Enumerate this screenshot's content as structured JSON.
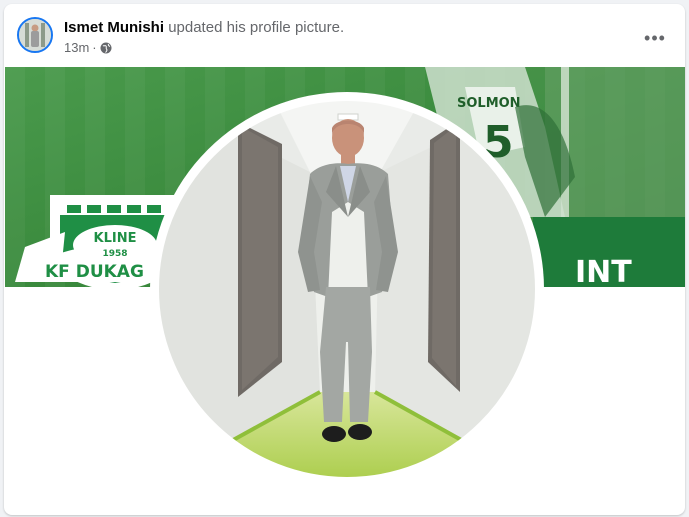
{
  "post": {
    "author_name": "Ismet Munishi",
    "action_text": "updated his profile picture.",
    "timestamp": "13m",
    "separator": "·",
    "privacy_icon": "globe-icon",
    "more_icon": "more-options-icon",
    "more_label": "•••"
  },
  "cover_photo": {
    "badge_text_top": "KLINE",
    "badge_year": "1958",
    "badge_text_bottom": "KF DUKAG",
    "jersey_name": "SOLMON",
    "jersey_number": "5",
    "overlay_text": "INT"
  },
  "colors": {
    "accent": "#1877f2",
    "grass": "#3d8c40",
    "floor": "#b7d35a"
  }
}
